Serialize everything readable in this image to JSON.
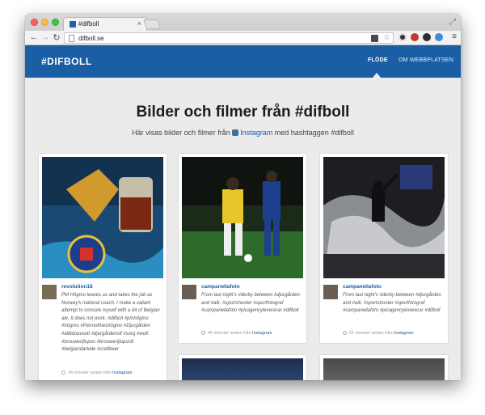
{
  "browser": {
    "tab_title": "#difboll",
    "tab_close": "×",
    "address": "difboll.se",
    "nav": {
      "back": "←",
      "forward": "→",
      "reload": "↻"
    },
    "star": "☆",
    "menu": "≡",
    "fullscreen": "⤢"
  },
  "site": {
    "brand": "#DIFBOLL",
    "nav": [
      {
        "label": "FLÖDE"
      },
      {
        "label": "OM WEBBPLATSEN"
      }
    ],
    "hero": {
      "title": "Bilder och filmer från #difboll",
      "sub_before": "Här visas bilder och filmer från",
      "sub_link": "Instagram",
      "sub_after": "med hashtaggen #difboll"
    },
    "posts": [
      {
        "user": "revolution18",
        "caption": "PM Högmo leaves us and takes the job as Norway's national coach. I make a valiant attempt to console myself with a bit of Belgian ale. It does not work. #difboll #pmhögmo #högmo #Permothieshögmo #Djurgården #alltidoavsett #djurgårdensif #sorg #wolf. #brouwerijlupus #brouwerijlupus8 #belgiandarkale #craftbeer",
        "time": "34 minuter sedan från",
        "source": "Instagram"
      },
      {
        "user": "campanellafoto",
        "caption": "From last night's #derby between #djurgården and #aik. #sportshooter #sportfotograf #campanellafoto #picagencylevererar #difboll",
        "time": "46 minuter sedan från",
        "source": "Instagram"
      },
      {
        "user": "campanellafoto",
        "caption": "From last night's #derby between #djurgården and #aik. #sportshooter #sportfotograf #campanellafoto #picagencylevererar #difboll",
        "time": "51 minuter sedan från",
        "source": "Instagram"
      }
    ]
  }
}
